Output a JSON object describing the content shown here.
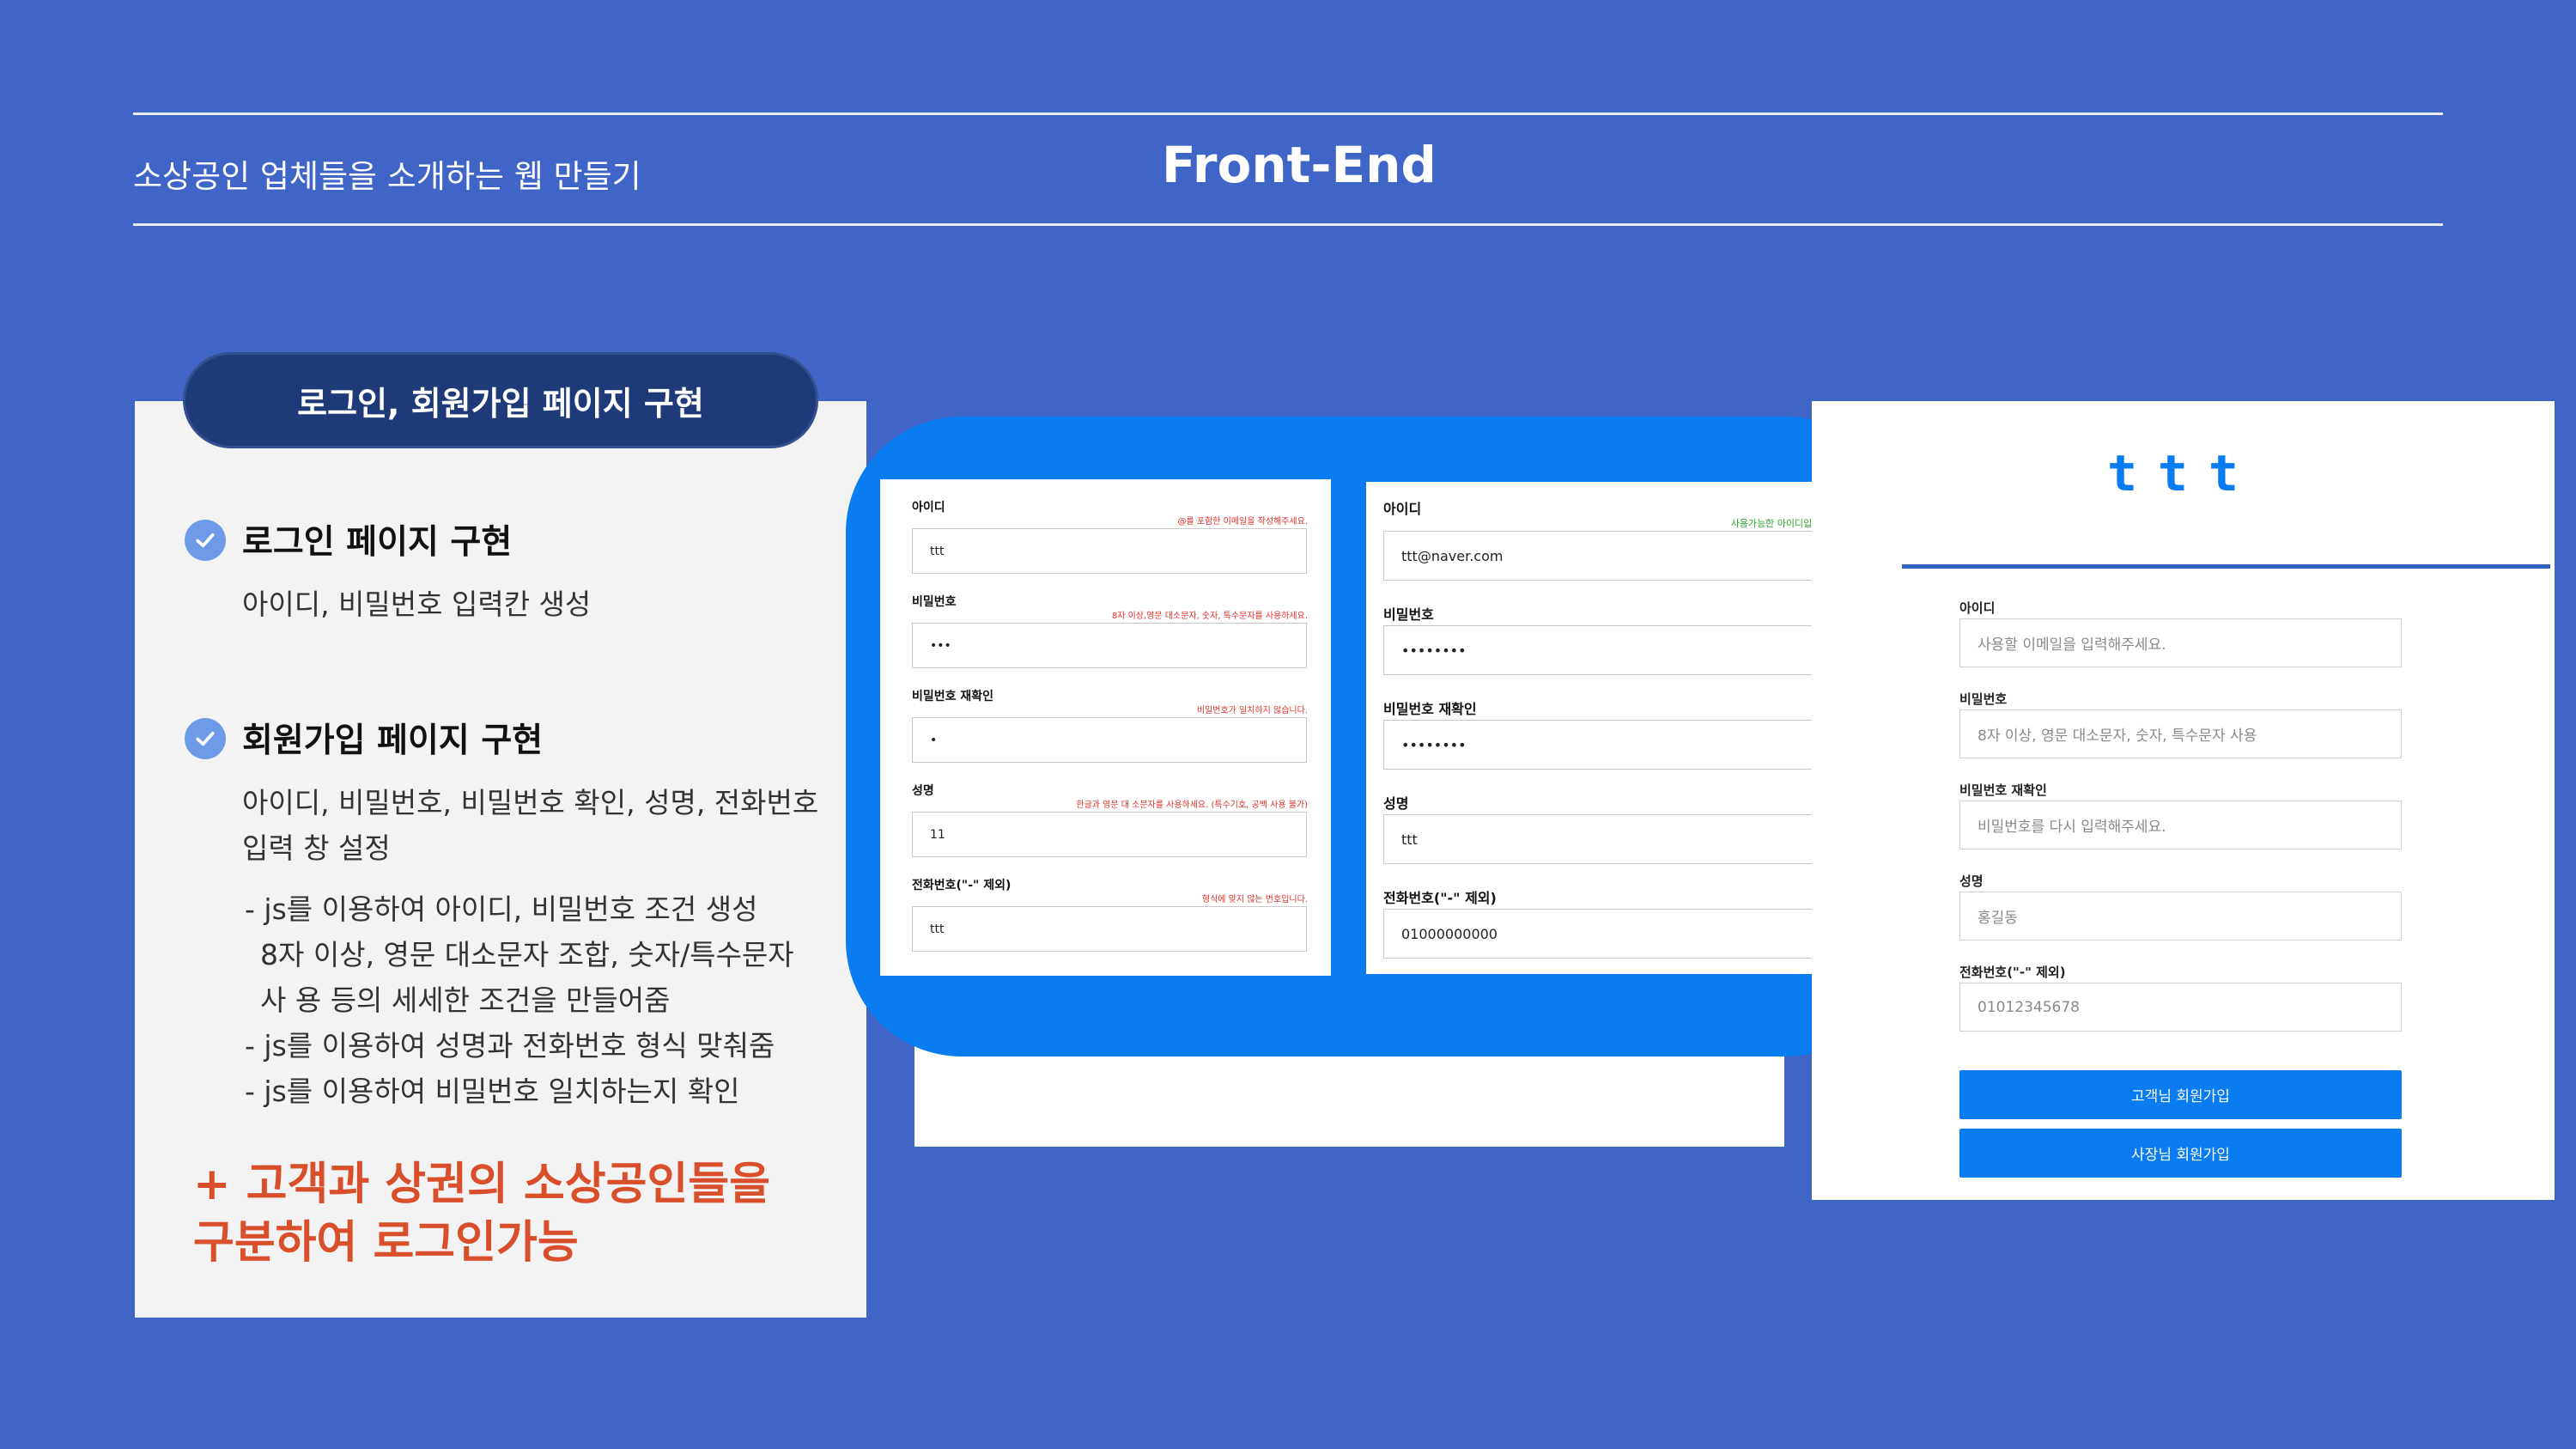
{
  "header": {
    "subtitle": "소상공인 업체들을 소개하는 웹 만들기",
    "title": "Front-End"
  },
  "left_card": {
    "pill_label": "로그인, 회원가입 페이지 구현",
    "section1_title": "로그인 페이지 구현",
    "section1_text": "아이디, 비밀번호 입력칸 생성",
    "section2_title": "회원가입 페이지 구현",
    "section2_text_line1": "아이디, 비밀번호, 비밀번호 확인, 성명, 전화번호",
    "section2_text_line2": "입력 창 설정",
    "bullet1_line1": "- js를 이용하여 아이디, 비밀번호 조건 생성",
    "bullet1_line2": "8자 이상, 영문 대소문자 조합, 숫자/특수문자",
    "bullet1_line3": "사 용 등의 세세한 조건을 만들어줌",
    "bullet2": "- js를 이용하여 성명과 전화번호 형식 맞춰줌",
    "bullet3": "- js를 이용하여 비밀번호 일치하는지 확인",
    "plus_line1": "+ 고객과 상권의 소상공인들을",
    "plus_line2": "구분하여 로그인가능"
  },
  "invalid_form": {
    "fields": [
      {
        "label": "아이디",
        "value": "ttt",
        "message": "@를 포함한 이메일을 작성해주세요."
      },
      {
        "label": "비밀번호",
        "value": "•••",
        "message": "8자 이상,영문 대소문자, 숫자, 특수문자를 사용하세요."
      },
      {
        "label": "비밀번호 재확인",
        "value": "•",
        "message": "비밀번호가 일치하지 않습니다."
      },
      {
        "label": "성명",
        "value": "11",
        "message": "한글과 영문 대 소문자를 사용하세요. (특수기호, 공백 사용 불가)"
      },
      {
        "label": "전화번호(\"-\" 제외)",
        "value": "ttt",
        "message": "형식에 맞지 않는 번호입니다."
      }
    ]
  },
  "valid_form": {
    "fields": [
      {
        "label": "아이디",
        "value": "ttt@naver.com",
        "message": "사용가능한 아이디입니다."
      },
      {
        "label": "비밀번호",
        "value": "••••••••",
        "message": ""
      },
      {
        "label": "비밀번호 재확인",
        "value": "••••••••",
        "message": ""
      },
      {
        "label": "성명",
        "value": "ttt",
        "message": ""
      },
      {
        "label": "전화번호(\"-\" 제외)",
        "value": "01000000000",
        "message": ""
      }
    ]
  },
  "signup_page": {
    "logo": "ttt",
    "fields": [
      {
        "label": "아이디",
        "placeholder": "사용할 이메일을 입력해주세요."
      },
      {
        "label": "비밀번호",
        "placeholder": "8자 이상, 영문 대소문자, 숫자, 특수문자 사용"
      },
      {
        "label": "비밀번호 재확인",
        "placeholder": "비밀번호를 다시 입력해주세요."
      },
      {
        "label": "성명",
        "placeholder": "홍길동"
      },
      {
        "label": "전화번호(\"-\" 제외)",
        "placeholder": "01012345678"
      }
    ],
    "customer_button": "고객님 회원가입",
    "owner_button": "사장님 회원가입"
  },
  "colors": {
    "background": "#3f65c7",
    "accent_blue": "#0a7cf2",
    "pill": "#1e3a78",
    "highlight_red": "#d94f2b",
    "error_red": "#e0302a",
    "success_green": "#2aa52a"
  }
}
